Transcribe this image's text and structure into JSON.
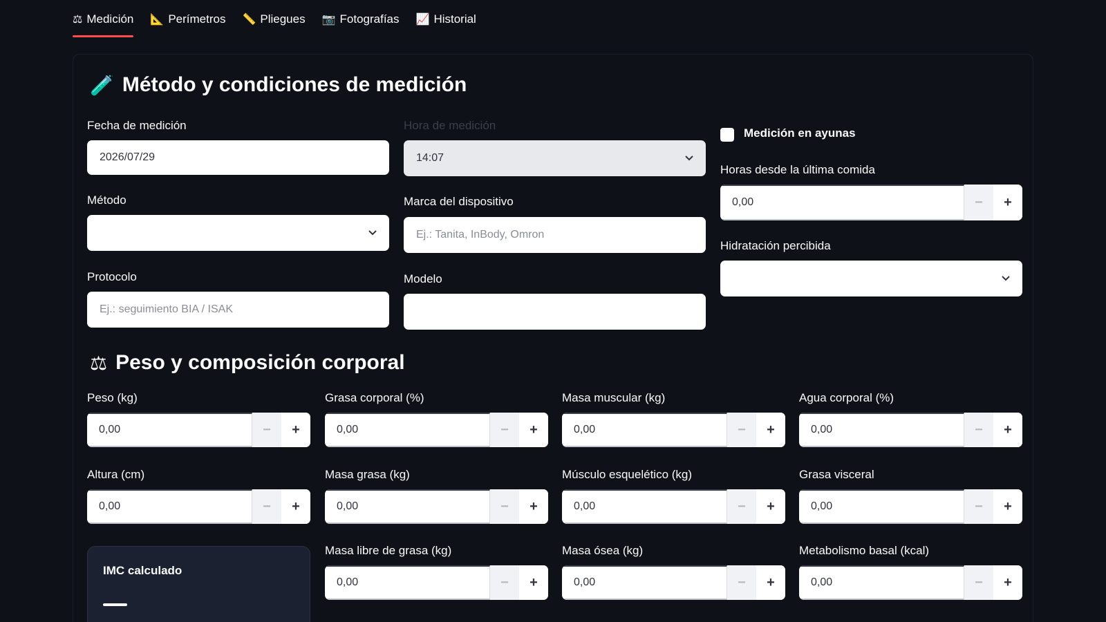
{
  "tabs": [
    {
      "label": "Medición",
      "icon": "⚖"
    },
    {
      "label": "Perímetros",
      "icon": "📐"
    },
    {
      "label": "Pliegues",
      "icon": "📏"
    },
    {
      "label": "Fotografías",
      "icon": "📷"
    },
    {
      "label": "Historial",
      "icon": "📈"
    }
  ],
  "colors": {
    "accent": "#ff4b4b",
    "background": "#0e1117"
  },
  "method_section": {
    "title": "Método y condiciones de medición",
    "icon": "🧪",
    "fecha": {
      "label": "Fecha de medición",
      "value": "2026/07/29"
    },
    "hora": {
      "label": "Hora de medición",
      "value": "14:07"
    },
    "ayunas": {
      "label": "Medición en ayunas"
    },
    "horas_comida": {
      "label": "Horas desde la última comida",
      "value": "0,00"
    },
    "metodo": {
      "label": "Método",
      "value": ""
    },
    "marca": {
      "label": "Marca del dispositivo",
      "placeholder": "Ej.: Tanita, InBody, Omron"
    },
    "hidratacion": {
      "label": "Hidratación percibida",
      "value": ""
    },
    "protocolo": {
      "label": "Protocolo",
      "placeholder": "Ej.: seguimiento BIA / ISAK"
    },
    "modelo": {
      "label": "Modelo",
      "value": ""
    }
  },
  "weight_section": {
    "title": "Peso y composición corporal",
    "icon": "⚖",
    "fields": [
      {
        "label": "Peso (kg)",
        "value": "0,00"
      },
      {
        "label": "Grasa corporal (%)",
        "value": "0,00"
      },
      {
        "label": "Masa muscular (kg)",
        "value": "0,00"
      },
      {
        "label": "Agua corporal (%)",
        "value": "0,00"
      },
      {
        "label": "Altura (cm)",
        "value": "0,00"
      },
      {
        "label": "Masa grasa (kg)",
        "value": "0,00"
      },
      {
        "label": "Músculo esquelético (kg)",
        "value": "0,00"
      },
      {
        "label": "Grasa visceral",
        "value": "0,00"
      },
      {
        "label": "Masa libre de grasa (kg)",
        "value": "0,00"
      },
      {
        "label": "Masa ósea (kg)",
        "value": "0,00"
      },
      {
        "label": "Metabolismo basal (kcal)",
        "value": "0,00"
      }
    ],
    "imc": {
      "label": "IMC calculado"
    }
  },
  "stepper": {
    "minus": "−",
    "plus": "+"
  }
}
